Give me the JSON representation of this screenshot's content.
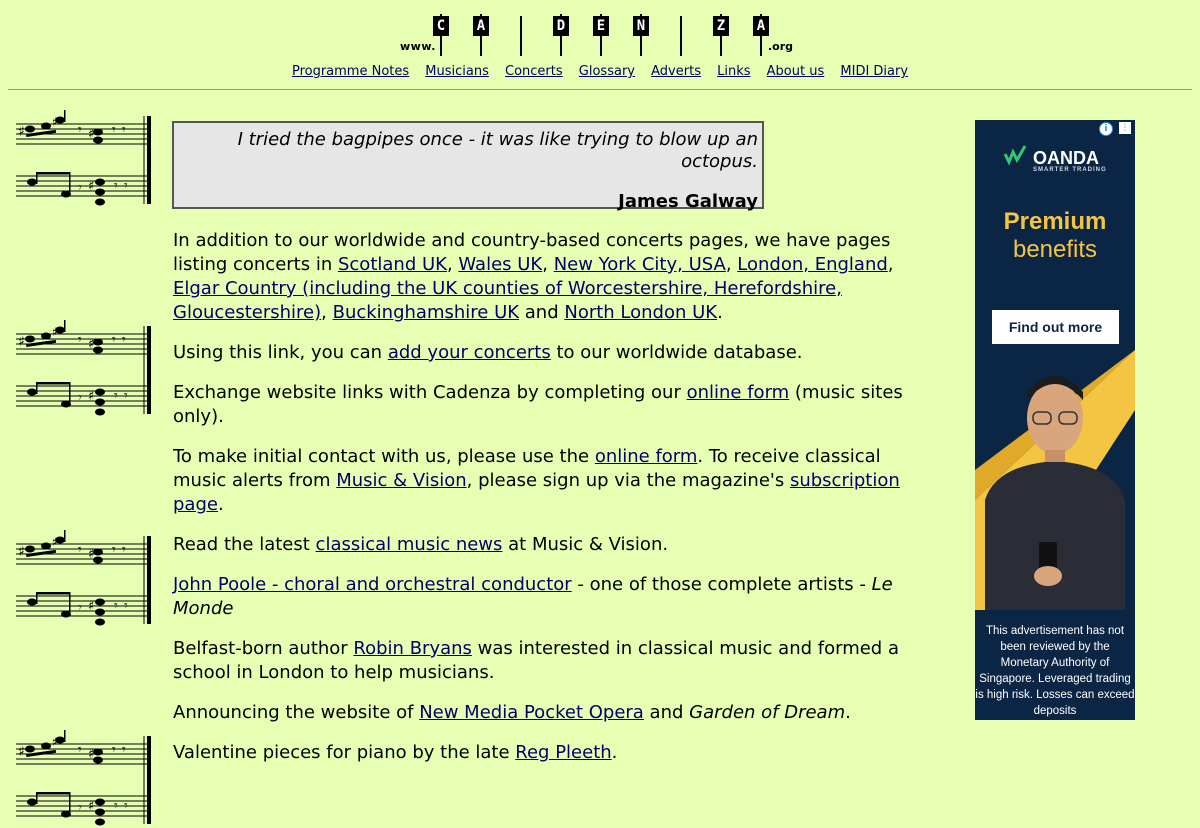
{
  "logo": {
    "prefix": "www.",
    "suffix": ".org",
    "keys": [
      "C",
      "A",
      "D",
      "E",
      "N",
      "Z",
      "A"
    ]
  },
  "nav": [
    "Programme Notes",
    "Musicians",
    "Concerts",
    "Glossary",
    "Adverts",
    "Links",
    "About us",
    "MIDI Diary"
  ],
  "quote": {
    "text": "I tried the bagpipes once - it was like trying to blow up an octopus.",
    "author": "James Galway"
  },
  "main": {
    "p1": {
      "t1": "In addition to our worldwide and country-based concerts pages, we have pages listing concerts in ",
      "l1": "Scotland UK",
      "t2": ", ",
      "l2": "Wales UK",
      "t3": ", ",
      "l3": "New York City, USA",
      "t4": ", ",
      "l4": "London, England",
      "t5": ", ",
      "l5": "Elgar Country (including the UK counties of Worcestershire, Herefordshire, Gloucestershire)",
      "t6": ", ",
      "l6": "Buckinghamshire UK",
      "t7": " and ",
      "l7": "North London UK",
      "t8": "."
    },
    "p2": {
      "t1": "Using this link, you can ",
      "l1": "add your concerts",
      "t2": " to our worldwide database."
    },
    "p3": {
      "t1": "Exchange website links with Cadenza by completing our ",
      "l1": "online form",
      "t2": " (music sites only)."
    },
    "p4": {
      "t1": "To make initial contact with us, please use the ",
      "l1": "online form",
      "t2": ". To receive classical music alerts from ",
      "l2": "Music & Vision",
      "t3": ", please sign up via the magazine's ",
      "l3": "subscription page",
      "t4": "."
    },
    "p5": {
      "t1": "Read the latest ",
      "l1": "classical music news",
      "t2": " at Music & Vision."
    },
    "p6": {
      "l1": "John Poole - choral and orchestral conductor",
      "t1": " - one of those complete artists - ",
      "i1": "Le Monde"
    },
    "p7": {
      "t1": "Belfast-born author ",
      "l1": "Robin Bryans",
      "t2": " was interested in classical music and formed a school in London to help musicians."
    },
    "p8": {
      "t1": "Announcing the website of ",
      "l1": "New Media Pocket Opera",
      "t2": " and ",
      "i1": "Garden of Dream",
      "t3": "."
    },
    "p9": {
      "t1": "Valentine pieces for piano by the late ",
      "l1": "Reg Pleeth",
      "t2": "."
    }
  },
  "ad": {
    "brand": "OANDA",
    "tagline": "SMARTER TRADING",
    "headline1": "Premium",
    "headline2": "benefits",
    "cta": "Find out more",
    "disclaimer": "This advertisement has not been reviewed by the Monetary Authority of Singapore. Leveraged trading is high risk. Losses can exceed deposits",
    "colors": {
      "bg": "#0b2545",
      "accent": "#f4c542"
    }
  }
}
